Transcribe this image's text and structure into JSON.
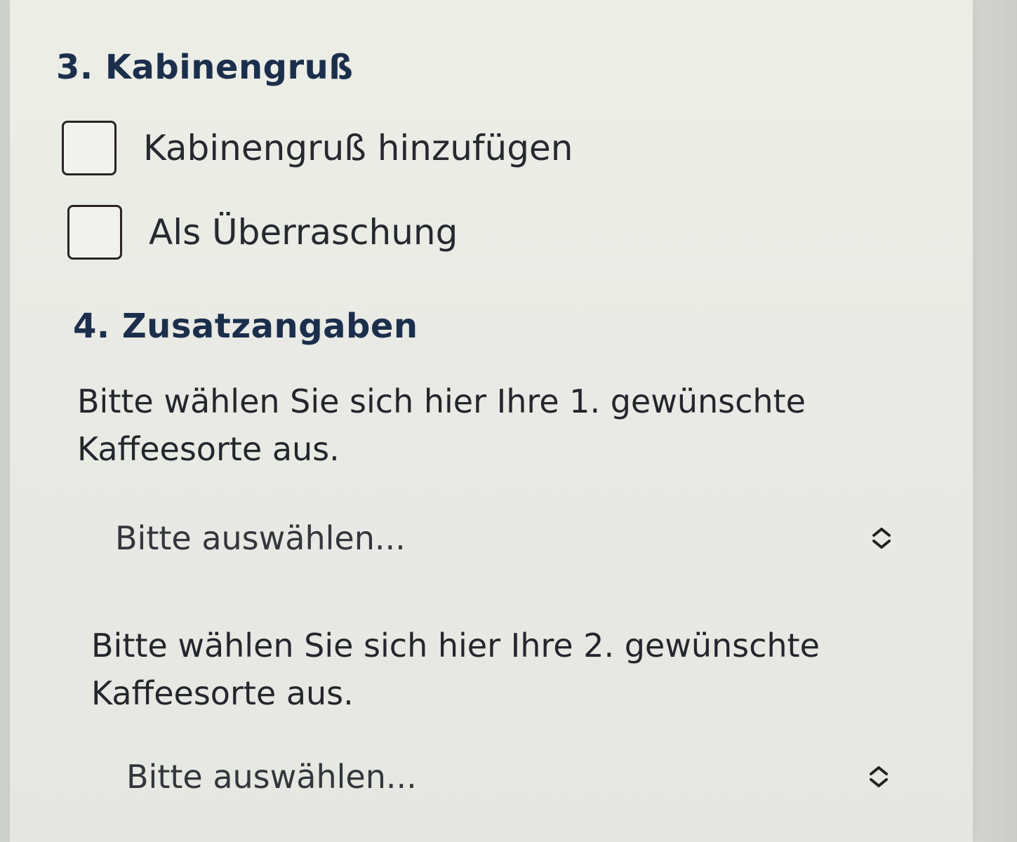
{
  "section3": {
    "title": "3. Kabinengruß",
    "options": [
      {
        "label": "Kabinengruß hinzufügen",
        "checked": false
      },
      {
        "label": "Als Überraschung",
        "checked": false
      }
    ]
  },
  "section4": {
    "title": "4. Zusatzangaben",
    "coffee1": {
      "prompt": "Bitte wählen Sie sich hier Ihre 1. gewünschte Kaffeesorte aus.",
      "selected": "Bitte auswählen...",
      "icon": "chevron-up-down-icon"
    },
    "coffee2": {
      "prompt": "Bitte wählen Sie sich hier Ihre 2. gewünschte Kaffeesorte aus.",
      "selected": "Bitte auswählen...",
      "icon": "chevron-up-down-icon"
    }
  },
  "colors": {
    "heading": "#1b2f4d",
    "text": "#23262b",
    "background": "#e9eae5"
  }
}
